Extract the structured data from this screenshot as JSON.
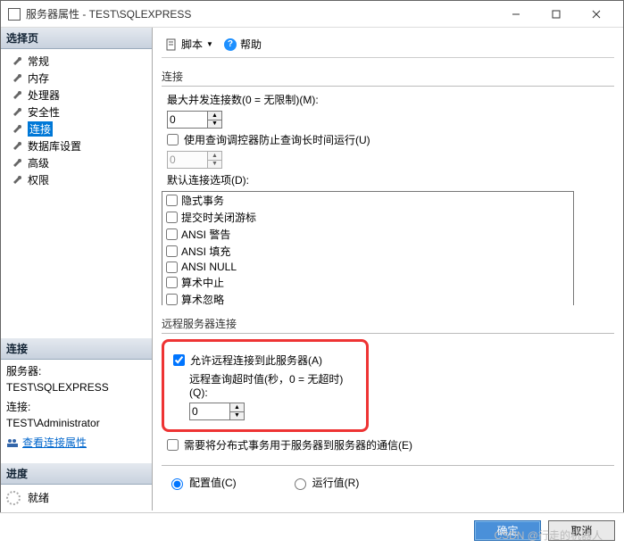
{
  "window": {
    "title": "服务器属性 - TEST\\SQLEXPRESS"
  },
  "sidebar": {
    "selectHeader": "选择页",
    "items": [
      {
        "label": "常规"
      },
      {
        "label": "内存"
      },
      {
        "label": "处理器"
      },
      {
        "label": "安全性"
      },
      {
        "label": "连接",
        "selected": true
      },
      {
        "label": "数据库设置"
      },
      {
        "label": "高级"
      },
      {
        "label": "权限"
      }
    ],
    "connHeader": "连接",
    "conn": {
      "serverLabel": "服务器:",
      "serverValue": "TEST\\SQLEXPRESS",
      "connLabel": "连接:",
      "connValue": "TEST\\Administrator",
      "viewPropsLink": "查看连接属性"
    },
    "progressHeader": "进度",
    "progress": {
      "status": "就绪"
    }
  },
  "topbar": {
    "script": "脚本",
    "help": "帮助"
  },
  "connections": {
    "header": "连接",
    "maxConcurrentLabel": "最大并发连接数(0 = 无限制)(M):",
    "maxConcurrentValue": "0",
    "useGovernorLabel": "使用查询调控器防止查询长时间运行(U)",
    "governorValue": "0",
    "defaultOptionsLabel": "默认连接选项(D):",
    "options": [
      "隐式事务",
      "提交时关闭游标",
      "ANSI 警告",
      "ANSI 填充",
      "ANSI NULL",
      "算术中止",
      "算术忽略"
    ]
  },
  "remote": {
    "header": "远程服务器连接",
    "allowRemoteLabel": "允许远程连接到此服务器(A)",
    "timeoutLabel": "远程查询超时值(秒，0 = 无超时)(Q):",
    "timeoutValue": "0",
    "distributedLabel": "需要将分布式事务用于服务器到服务器的通信(E)"
  },
  "radios": {
    "configured": "配置值(C)",
    "running": "运行值(R)"
  },
  "footer": {
    "ok": "确定",
    "cancel": "取消"
  },
  "watermark": "CSDN @行走的机器人"
}
